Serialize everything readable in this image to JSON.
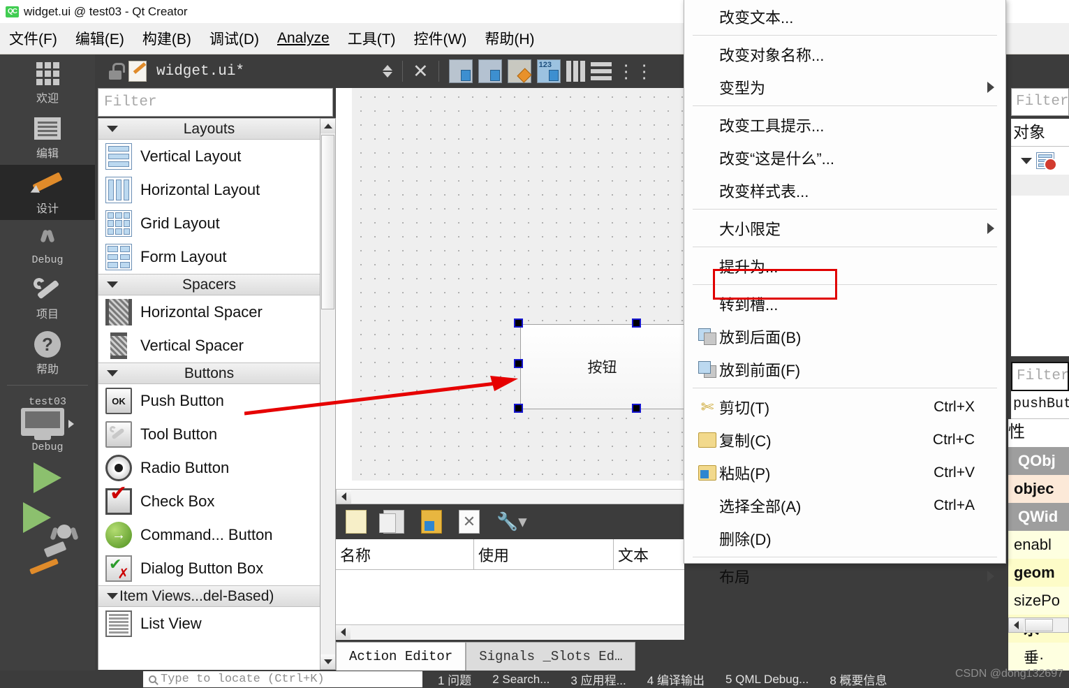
{
  "window": {
    "logo_text": "QC",
    "title": "widget.ui @ test03 - Qt Creator"
  },
  "menubar": {
    "items": [
      {
        "label": "文件(F)",
        "mnemonic": "F"
      },
      {
        "label": "编辑(E)",
        "mnemonic": "E"
      },
      {
        "label": "构建(B)",
        "mnemonic": "B"
      },
      {
        "label": "调试(D)",
        "mnemonic": "D"
      },
      {
        "label": "Analyze",
        "mnemonic": "A"
      },
      {
        "label": "工具(T)",
        "mnemonic": "T"
      },
      {
        "label": "控件(W)",
        "mnemonic": "W"
      },
      {
        "label": "帮助(H)",
        "mnemonic": "H"
      }
    ]
  },
  "mode_sidebar": {
    "items": [
      {
        "label": "欢迎",
        "icon": "grid-icon",
        "selected": false
      },
      {
        "label": "编辑",
        "icon": "document-lines-icon",
        "selected": false
      },
      {
        "label": "设计",
        "icon": "pencil-icon",
        "selected": true
      },
      {
        "label": "Debug",
        "icon": "bug-icon",
        "selected": false
      },
      {
        "label": "项目",
        "icon": "wrench-icon",
        "selected": false
      },
      {
        "label": "帮助",
        "icon": "question-circle-icon",
        "selected": false
      }
    ],
    "kit": {
      "project_name": "test03",
      "build_config": "Debug",
      "icon": "monitor-icon"
    },
    "actions": [
      {
        "name": "run-button",
        "icon": "play-triangle-icon"
      },
      {
        "name": "debug-button",
        "icon": "play-bug-icon"
      },
      {
        "name": "build-button",
        "icon": "hammer-icon"
      }
    ]
  },
  "editor_toolbar": {
    "lock_icon": "unlocked-icon",
    "file_icon": "ui-file-icon",
    "filename": "widget.ui*",
    "nav_icon": "updown-arrows-icon",
    "close_icon": "close-x-icon",
    "mode_buttons": [
      {
        "name": "edit-widgets-button",
        "icon": "edit-widgets-icon"
      },
      {
        "name": "edit-signals-slots-button",
        "icon": "signals-slots-icon"
      },
      {
        "name": "edit-buddies-button",
        "icon": "buddies-icon"
      },
      {
        "name": "edit-tab-order-button",
        "icon": "tab-order-icon"
      }
    ],
    "layout_buttons": [
      {
        "name": "layout-horizontally-button",
        "icon": "layout-horizontal-icon"
      },
      {
        "name": "layout-vertically-button",
        "icon": "layout-vertical-icon"
      },
      {
        "name": "layout-splitter-button",
        "icon": "layout-splitter-icon"
      }
    ]
  },
  "widget_box": {
    "filter_placeholder": "Filter",
    "groups": [
      {
        "title": "Layouts",
        "expanded": true,
        "items": [
          {
            "label": "Vertical Layout",
            "icon": "vertical-layout-icon"
          },
          {
            "label": "Horizontal Layout",
            "icon": "horizontal-layout-icon"
          },
          {
            "label": "Grid Layout",
            "icon": "grid-layout-icon"
          },
          {
            "label": "Form Layout",
            "icon": "form-layout-icon"
          }
        ]
      },
      {
        "title": "Spacers",
        "expanded": true,
        "items": [
          {
            "label": "Horizontal Spacer",
            "icon": "horizontal-spacer-icon"
          },
          {
            "label": "Vertical Spacer",
            "icon": "vertical-spacer-icon"
          }
        ]
      },
      {
        "title": "Buttons",
        "expanded": true,
        "items": [
          {
            "label": "Push Button",
            "icon": "push-button-icon"
          },
          {
            "label": "Tool Button",
            "icon": "tool-button-icon"
          },
          {
            "label": "Radio Button",
            "icon": "radio-button-icon"
          },
          {
            "label": "Check Box",
            "icon": "check-box-icon"
          },
          {
            "label": "Command... Button",
            "icon": "command-link-button-icon"
          },
          {
            "label": "Dialog Button Box",
            "icon": "dialog-button-box-icon"
          }
        ]
      },
      {
        "title": "Item Views...del-Based)",
        "expanded": true,
        "items": [
          {
            "label": "List View",
            "icon": "list-view-icon"
          }
        ]
      }
    ]
  },
  "canvas": {
    "selected_widget": {
      "text": "按钮",
      "selected": true,
      "handle_color": "#1515cf"
    },
    "annotation": {
      "type": "arrow",
      "color": "#e60000",
      "from": "Push Button",
      "to": "按钮"
    }
  },
  "action_editor": {
    "toolbar": [
      {
        "name": "new-action-button",
        "icon": "new-file-icon"
      },
      {
        "name": "copy-action-button",
        "icon": "copy-icon"
      },
      {
        "name": "paste-action-button",
        "icon": "paste-icon"
      },
      {
        "name": "delete-action-button",
        "icon": "delete-file-icon"
      },
      {
        "name": "configure-button",
        "icon": "wrench-dropdown-icon"
      }
    ],
    "columns": [
      "名称",
      "使用",
      "文本"
    ],
    "rows": [],
    "tabs": [
      {
        "label": "Action Editor",
        "active": true
      },
      {
        "label": "Signals _Slots Ed…",
        "active": false
      }
    ]
  },
  "object_inspector": {
    "filter_placeholder": "Filter",
    "column_header": "对象",
    "rows": [
      {
        "label": "",
        "icon": "widget-disabled-icon",
        "expanded": true
      }
    ]
  },
  "property_editor": {
    "filter_placeholder": "Filter",
    "selected_object": "pushBut",
    "header": "性",
    "rows": [
      {
        "label": "QObj",
        "type": "group"
      },
      {
        "label": "objec",
        "type": "peach"
      },
      {
        "label": "QWid",
        "type": "group"
      },
      {
        "label": "enabl",
        "type": "ylite"
      },
      {
        "label": "geom",
        "type": "ydark"
      },
      {
        "label": "sizePo",
        "type": "ylite"
      },
      {
        "label": "水·",
        "type": "ydark",
        "indent": true
      },
      {
        "label": "垂·",
        "type": "ylite",
        "indent": true
      }
    ]
  },
  "context_menu": {
    "highlight_color": "#e00000",
    "items": [
      {
        "label": "改变文本...",
        "icon": null,
        "shortcut": null,
        "submenu": false
      },
      {
        "type": "separator"
      },
      {
        "label": "改变对象名称...",
        "icon": null,
        "shortcut": null,
        "submenu": false
      },
      {
        "label": "变型为",
        "icon": null,
        "shortcut": null,
        "submenu": true
      },
      {
        "type": "separator"
      },
      {
        "label": "改变工具提示...",
        "icon": null,
        "shortcut": null,
        "submenu": false
      },
      {
        "label": "改变“这是什么”...",
        "icon": null,
        "shortcut": null,
        "submenu": false
      },
      {
        "label": "改变样式表...",
        "icon": null,
        "shortcut": null,
        "submenu": false
      },
      {
        "type": "separator"
      },
      {
        "label": "大小限定",
        "icon": null,
        "shortcut": null,
        "submenu": true
      },
      {
        "type": "separator"
      },
      {
        "label": "提升为...",
        "icon": null,
        "shortcut": null,
        "submenu": false
      },
      {
        "type": "separator"
      },
      {
        "label": "转到槽...",
        "icon": null,
        "shortcut": null,
        "submenu": false,
        "highlighted": true
      },
      {
        "label": "放到后面(B)",
        "icon": "send-to-back-icon",
        "shortcut": null,
        "submenu": false
      },
      {
        "label": "放到前面(F)",
        "icon": "bring-to-front-icon",
        "shortcut": null,
        "submenu": false
      },
      {
        "type": "separator"
      },
      {
        "label": "剪切(T)",
        "icon": "scissors-icon",
        "shortcut": "Ctrl+X",
        "submenu": false
      },
      {
        "label": "复制(C)",
        "icon": "copy-icon",
        "shortcut": "Ctrl+C",
        "submenu": false
      },
      {
        "label": "粘贴(P)",
        "icon": "paste-icon",
        "shortcut": "Ctrl+V",
        "submenu": false
      },
      {
        "label": "选择全部(A)",
        "icon": null,
        "shortcut": "Ctrl+A",
        "submenu": false
      },
      {
        "label": "删除(D)",
        "icon": null,
        "shortcut": null,
        "submenu": false
      },
      {
        "type": "separator"
      },
      {
        "label": "布局",
        "icon": null,
        "shortcut": null,
        "submenu": true
      }
    ]
  },
  "status_bar": {
    "locator_placeholder": "Type to locate (Ctrl+K)",
    "output_buttons": [
      "1 问题",
      "2 Search...",
      "3 应用程...",
      "4 编译输出",
      "5 QML Debug...",
      "8 概要信息"
    ]
  },
  "watermark": "CSDN @dong132697"
}
